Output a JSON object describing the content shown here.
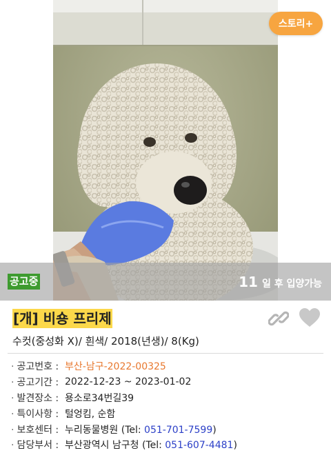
{
  "story_button": "스토리+",
  "status": {
    "badge": "공고중",
    "days": "11",
    "suffix": "일 후 입양가능"
  },
  "animal": {
    "title": "[개] 비숑 프리제",
    "summary": "수컷(중성화 X)/ 흰색/ 2018(년생)/ 8(Kg)"
  },
  "details": [
    {
      "label": "공고번호 :",
      "value": "부산-남구-2022-00325"
    },
    {
      "label": "공고기간 :",
      "value": "2022-12-23 ~ 2023-01-02"
    },
    {
      "label": "발견장소 :",
      "value": "용소로34번길39"
    },
    {
      "label": "특이사항 :",
      "value": "털엉킴, 순함"
    },
    {
      "label": "보호센터 :",
      "value": "누리동물병원 (Tel: ",
      "tel": "051-701-7599",
      "close": ")"
    },
    {
      "label": "담당부서 :",
      "value": "부산광역시 남구청 (Tel: ",
      "tel": "051-607-4481",
      "close": ")"
    }
  ],
  "colors": {
    "accent_orange": "#f7a540",
    "badge_green": "#3e9b2f",
    "title_highlight": "#fcd84a",
    "notice_number": "#e8782e",
    "tel_link": "#2b3fc7"
  },
  "icons": [
    "link-icon",
    "heart-icon"
  ]
}
